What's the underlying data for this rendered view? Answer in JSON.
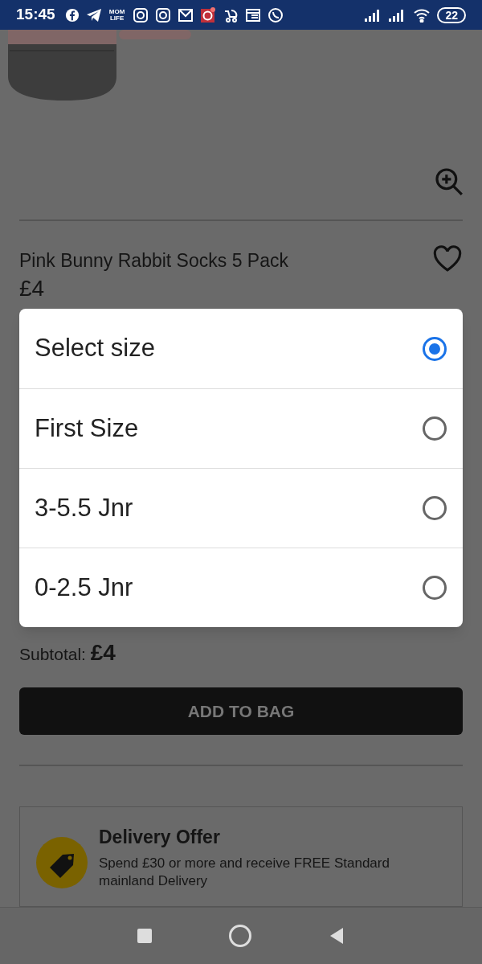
{
  "status_bar": {
    "time": "15:45",
    "app_label": "MOM LIFE",
    "battery": "22"
  },
  "product": {
    "title": "Pink Bunny Rabbit Socks 5 Pack",
    "price": "£4",
    "favorite": false
  },
  "size_dialog": {
    "options": [
      {
        "label": "Select size",
        "selected": true
      },
      {
        "label": "First Size",
        "selected": false
      },
      {
        "label": "3-5.5 Jnr",
        "selected": false
      },
      {
        "label": "0-2.5 Jnr",
        "selected": false
      }
    ]
  },
  "subtotal": {
    "label": "Subtotal:",
    "value": "£4"
  },
  "add_button": {
    "label": "ADD TO BAG",
    "disabled": true
  },
  "delivery": {
    "title": "Delivery Offer",
    "text": "Spend £30 or more and receive FREE Standard mainland Delivery"
  }
}
